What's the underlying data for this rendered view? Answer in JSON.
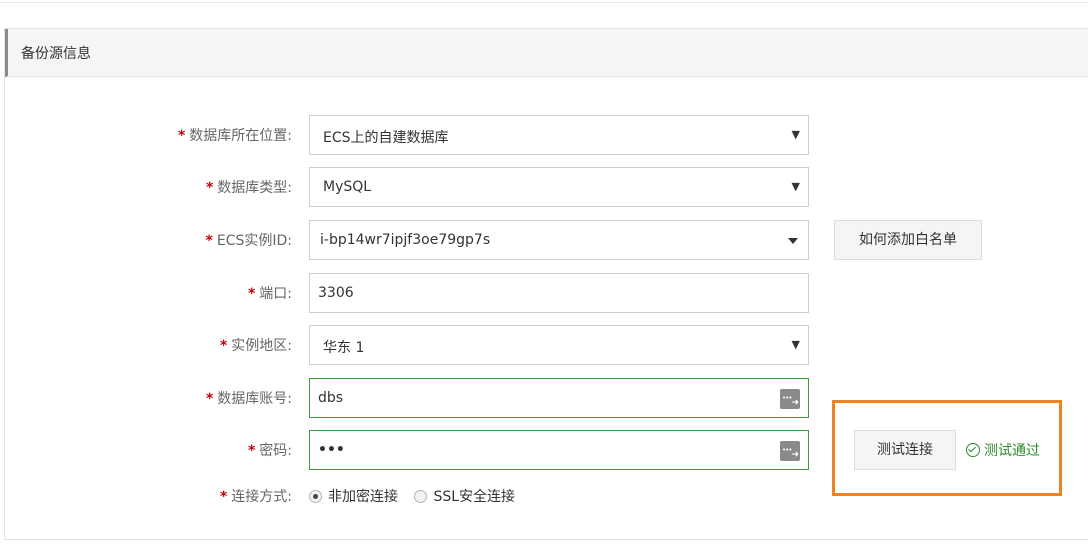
{
  "panel": {
    "title": "备份源信息"
  },
  "form": {
    "location": {
      "label": "数据库所在位置:",
      "value": "ECS上的自建数据库"
    },
    "db_type": {
      "label": "数据库类型:",
      "value": "MySQL"
    },
    "ecs_id": {
      "label": "ECS实例ID:",
      "value": "i-bp14wr7ipjf3oe79gp7s"
    },
    "port": {
      "label": "端口:",
      "value": "3306"
    },
    "region": {
      "label": "实例地区:",
      "value": "华东 1"
    },
    "account": {
      "label": "数据库账号:",
      "value": "dbs"
    },
    "password": {
      "label": "密码:",
      "value": "•••"
    },
    "connection": {
      "label": "连接方式:",
      "options": [
        {
          "label": "非加密连接",
          "checked": true
        },
        {
          "label": "SSL安全连接",
          "checked": false
        }
      ]
    },
    "required_mark": "*"
  },
  "buttons": {
    "whitelist": "如何添加白名单",
    "test_connection": "测试连接"
  },
  "status": {
    "test_result": "测试通过",
    "color": "#2e8b2e"
  },
  "colors": {
    "required": "#c40000",
    "highlight": "#f08424",
    "valid_border": "#3f9b3f"
  },
  "icons": {
    "dropdown": "caret-down-icon",
    "key": "key-icon",
    "check": "check-circle-icon"
  }
}
